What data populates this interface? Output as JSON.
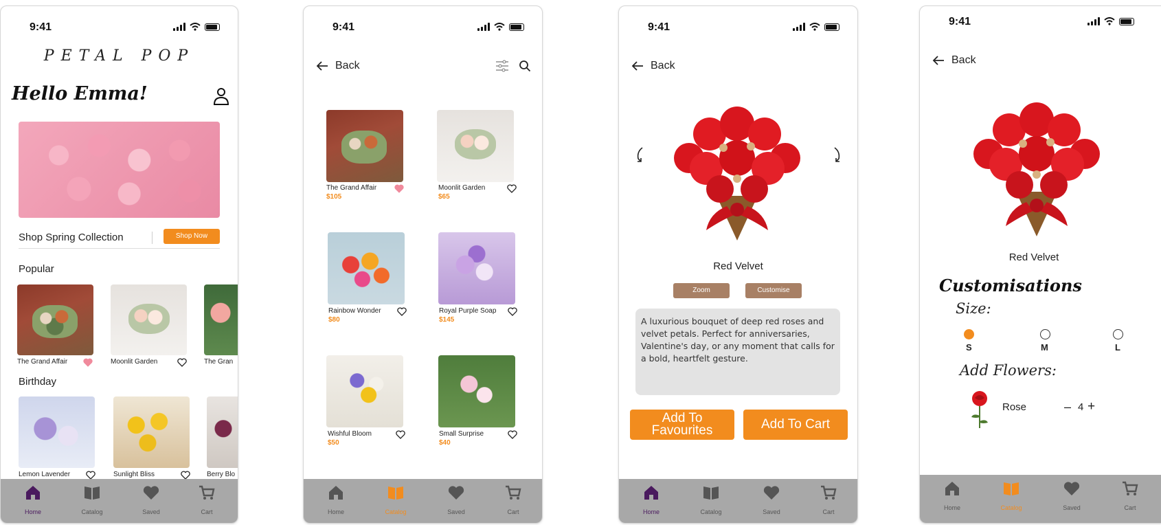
{
  "status": {
    "time": "9:41"
  },
  "home": {
    "brand": "PETAL POP",
    "greeting": "Hello Emma!",
    "spring_label": "Shop Spring Collection",
    "shop_now": "Shop Now",
    "popular_title": "Popular",
    "birthday_title": "Birthday",
    "popular": [
      {
        "name": "The Grand Affair",
        "liked": true
      },
      {
        "name": "Moonlit Garden",
        "liked": false
      },
      {
        "name": "The Gran",
        "liked": false
      }
    ],
    "birthday": [
      {
        "name": "Lemon Lavender",
        "liked": false
      },
      {
        "name": "Sunlight Bliss",
        "liked": false
      },
      {
        "name": "Berry Blo",
        "liked": false
      }
    ]
  },
  "catalog": {
    "back": "Back",
    "items": [
      {
        "name": "The Grand Affair",
        "price": "$105",
        "liked": true
      },
      {
        "name": "Moonlit Garden",
        "price": "$65",
        "liked": false
      },
      {
        "name": "Rainbow Wonder",
        "price": "$80",
        "liked": false
      },
      {
        "name": "Royal Purple Soap",
        "price": "$145",
        "liked": false
      },
      {
        "name": "Wishful Bloom",
        "price": "$50",
        "liked": false
      },
      {
        "name": "Small Surprise",
        "price": "$40",
        "liked": false
      }
    ]
  },
  "detail": {
    "back": "Back",
    "product_name": "Red Velvet",
    "zoom": "Zoom",
    "customise": "Customise",
    "description": "A luxurious bouquet of deep red roses and velvet petals. Perfect for anniversaries, Valentine's day, or any moment that calls for a bold, heartfelt gesture.",
    "add_fav_line1": "Add To",
    "add_fav_line2": "Favourites",
    "add_cart": "Add To Cart"
  },
  "customise": {
    "back": "Back",
    "product_name": "Red Velvet",
    "title": "Customisations",
    "size_label": "Size:",
    "sizes": [
      "S",
      "M",
      "L"
    ],
    "selected_size": "S",
    "add_flowers_label": "Add Flowers:",
    "flower_name": "Rose",
    "minus": "–",
    "quantity": "4",
    "plus": "+"
  },
  "tabs": {
    "home": "Home",
    "catalog": "Catalog",
    "saved": "Saved",
    "cart": "Cart"
  },
  "colors": {
    "accent": "#f28c1e",
    "home_active": "#4a1a5e",
    "tabbar": "#a8a8a8",
    "brown_button": "#a88065"
  },
  "icons": {
    "home": "house-icon",
    "catalog": "book-icon",
    "saved": "heart-icon",
    "cart": "cart-icon"
  }
}
